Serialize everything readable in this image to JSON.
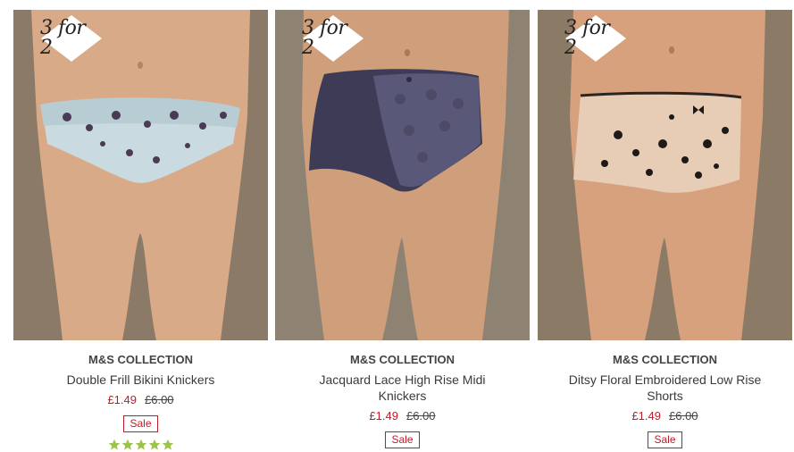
{
  "products": [
    {
      "promo": "3 for 2",
      "brand": "M&S COLLECTION",
      "name": "Double Frill Bikini Knickers",
      "price_now": "£1.49",
      "price_was": "£6.00",
      "badge": "Sale",
      "rating": 5,
      "image_desc": "floral-frill-bikini-photo",
      "colors": {
        "background": "#8a7a67",
        "garment": "#c9dbe0",
        "accent": "#4b3a55"
      }
    },
    {
      "promo": "3 for 2",
      "brand": "M&S COLLECTION",
      "name": "Jacquard Lace High Rise Midi Knickers",
      "price_now": "£1.49",
      "price_was": "£6.00",
      "badge": "Sale",
      "rating": null,
      "image_desc": "navy-lace-midi-photo",
      "colors": {
        "background": "#8e8273",
        "garment": "#3d3b56",
        "accent": "#5a5878"
      }
    },
    {
      "promo": "3 for 2",
      "brand": "M&S COLLECTION",
      "name": "Ditsy Floral Embroidered Low Rise Shorts",
      "price_now": "£1.49",
      "price_was": "£6.00",
      "badge": "Sale",
      "rating": null,
      "image_desc": "embroidered-shorts-photo",
      "colors": {
        "background": "#8b7a66",
        "garment": "#e8cdb6",
        "accent": "#1e1a18"
      }
    }
  ],
  "theme": {
    "sale_color": "#c31a2a",
    "star_color": "#9cc44a"
  }
}
